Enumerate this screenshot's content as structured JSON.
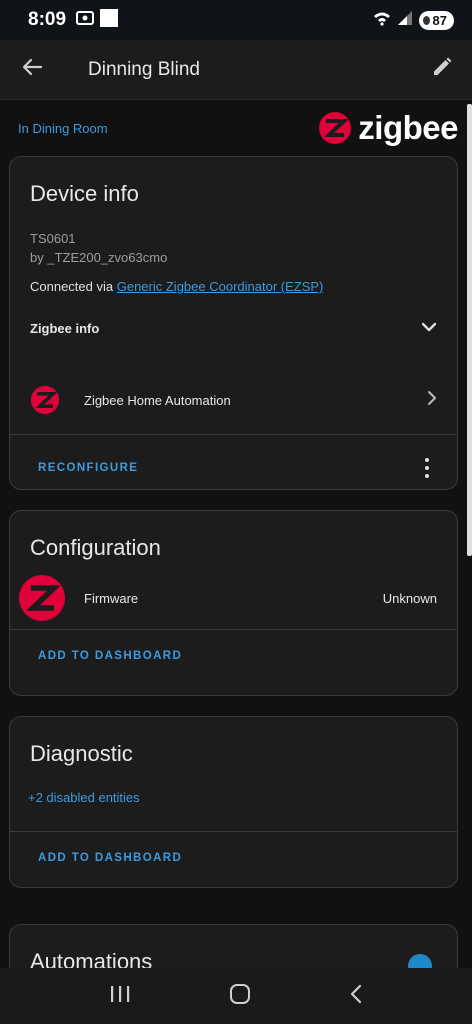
{
  "status_bar": {
    "time": "8:09",
    "battery": "87"
  },
  "app_bar": {
    "title": "Dinning Blind"
  },
  "area": {
    "label": "In Dining Room"
  },
  "brand": {
    "name": "zigbee",
    "color": "#e0003a"
  },
  "device_info": {
    "title": "Device info",
    "model": "TS0601",
    "manufacturer": "by _TZE200_zvo63cmo",
    "connected_prefix": "Connected via ",
    "connected_link": "Generic Zigbee Coordinator (EZSP)",
    "zigbee_info_label": "Zigbee info",
    "integration_label": "Zigbee Home Automation",
    "reconfigure_label": "RECONFIGURE"
  },
  "configuration": {
    "title": "Configuration",
    "entity_label": "Firmware",
    "entity_state": "Unknown",
    "add_label": "ADD TO DASHBOARD"
  },
  "diagnostic": {
    "title": "Diagnostic",
    "disabled_entities": "+2 disabled entities",
    "add_label": "ADD TO DASHBOARD"
  },
  "automations": {
    "title": "Automations"
  },
  "colors": {
    "accent": "#3d9be0",
    "card_bg": "#1c1c1c",
    "page_bg": "#111111"
  }
}
